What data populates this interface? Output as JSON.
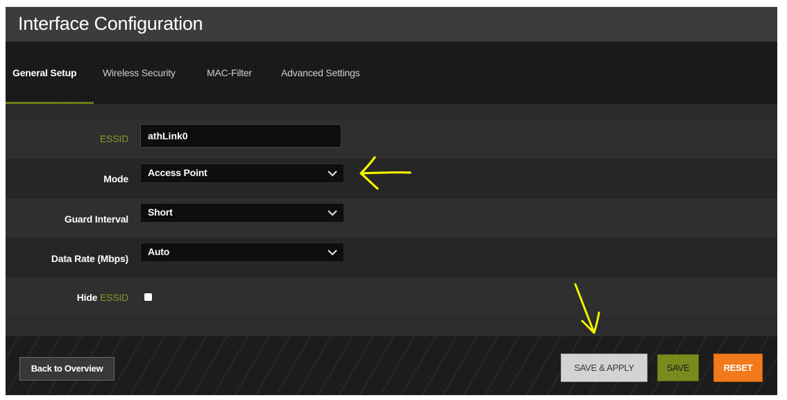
{
  "header": {
    "title": "Interface Configuration"
  },
  "tabs": [
    {
      "label": "General Setup",
      "active": true
    },
    {
      "label": "Wireless Security",
      "active": false
    },
    {
      "label": "MAC-Filter",
      "active": false
    },
    {
      "label": "Advanced Settings",
      "active": false
    }
  ],
  "form": {
    "essid": {
      "label": "ESSID",
      "value": "athLink0"
    },
    "mode": {
      "label": "Mode",
      "value": "Access Point"
    },
    "guard_interval": {
      "label": "Guard Interval",
      "value": "Short"
    },
    "data_rate": {
      "label": "Data Rate (Mbps)",
      "value": "Auto"
    },
    "hide_essid": {
      "label_prefix": "Hide",
      "label_abbr": "ESSID",
      "checked": false
    }
  },
  "footer": {
    "back_label": "Back to Overview",
    "save_apply_label": "Save & Apply",
    "save_label": "Save",
    "reset_label": "Reset"
  },
  "colors": {
    "accent_green": "#7a8a1c",
    "reset_orange": "#f07a1c",
    "annotation_yellow": "#f5f500"
  },
  "icons": {
    "dropdown": "chevron-down-icon",
    "annotation": "arrow-annotation"
  }
}
